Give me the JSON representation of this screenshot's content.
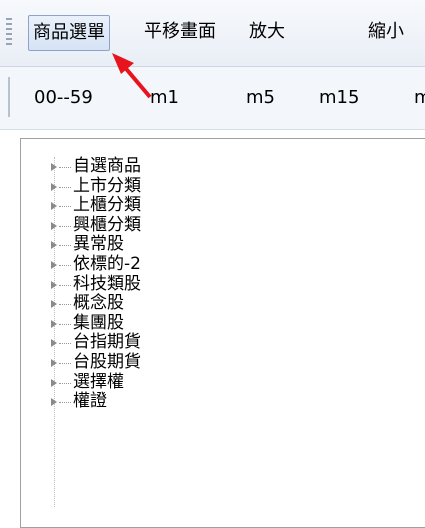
{
  "menu": {
    "items": [
      {
        "label": "商品選單",
        "active": true
      },
      {
        "label": "平移畫面",
        "active": false
      },
      {
        "label": "放大",
        "active": false
      },
      {
        "label": "縮小",
        "active": false
      }
    ]
  },
  "toolbar": {
    "items": [
      "00--59",
      "m1",
      "m5",
      "m15",
      "m"
    ]
  },
  "tree": {
    "items": [
      "自選商品",
      "上市分類",
      "上櫃分類",
      "興櫃分類",
      "異常股",
      "依標的-2",
      "科技類股",
      "概念股",
      "集團股",
      "台指期貨",
      "台股期貨",
      "選擇權",
      "權證"
    ]
  },
  "annotation": {
    "color": "#e8141d"
  }
}
